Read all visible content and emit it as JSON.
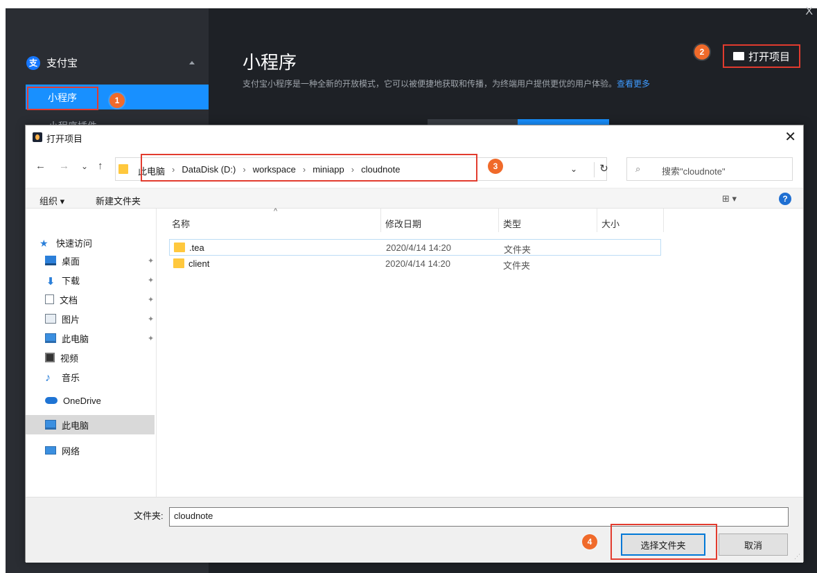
{
  "app": {
    "brand": "支付宝",
    "brand_logo": "支",
    "menu_active": "小程序",
    "menu_next": "小程序插件",
    "title": "小程序",
    "description": "支付宝小程序是一种全新的开放模式，它可以被便捷地获取和传播，为终端用户提供更优的用户体验。",
    "more_link": "查看更多",
    "open_project": "打开项目",
    "close": "X"
  },
  "badges": [
    "1",
    "2",
    "3",
    "4"
  ],
  "dialog": {
    "title": "打开项目",
    "close": "✕",
    "nav": {
      "back": "←",
      "forward": "→",
      "recent": "⌄",
      "up": "↑"
    },
    "breadcrumbs": [
      "此电脑",
      "DataDisk (D:)",
      "workspace",
      "miniapp",
      "cloudnote"
    ],
    "crumb_separator": "›",
    "address_dropdown": "⌄",
    "refresh": "↻",
    "search_icon": "⌕",
    "search_placeholder": "搜索\"cloudnote\"",
    "toolbar": {
      "organize": "组织 ▾",
      "new_folder": "新建文件夹",
      "view": "⊞ ▾",
      "help": "?"
    },
    "nav_pane": [
      {
        "label": "快速访问",
        "icon": "star-icon",
        "glyph": "★"
      },
      {
        "label": "桌面",
        "icon": "desktop-icon",
        "pinned": true,
        "pin": "✦"
      },
      {
        "label": "下载",
        "icon": "download-icon",
        "glyph": "⬇",
        "pinned": true,
        "pin": "✦"
      },
      {
        "label": "文档",
        "icon": "documents-icon",
        "pinned": true,
        "pin": "✦"
      },
      {
        "label": "图片",
        "icon": "pictures-icon",
        "pinned": true,
        "pin": "✦"
      },
      {
        "label": "此电脑",
        "icon": "computer-icon",
        "pinned": true,
        "pin": "✦"
      },
      {
        "label": "视频",
        "icon": "video-icon"
      },
      {
        "label": "音乐",
        "icon": "music-icon",
        "glyph": "♪"
      },
      {
        "label": "OneDrive",
        "icon": "onedrive-icon"
      },
      {
        "label": "此电脑",
        "icon": "computer-icon",
        "selected": true
      },
      {
        "label": "网络",
        "icon": "network-icon"
      }
    ],
    "columns": {
      "name": "名称",
      "sort": "^",
      "date": "修改日期",
      "type": "类型",
      "size": "大小"
    },
    "files": [
      {
        "name": ".tea",
        "date": "2020/4/14 14:20",
        "type": "文件夹"
      },
      {
        "name": "client",
        "date": "2020/4/14 14:20",
        "type": "文件夹"
      }
    ],
    "footer": {
      "folder_label": "文件夹:",
      "folder_value": "cloudnote",
      "select_button": "选择文件夹",
      "cancel_button": "取消",
      "grip": "⋰"
    }
  },
  "colors": {
    "highlight": "#e23b2e",
    "badge": "#f06a2a",
    "accent": "#1890ff"
  }
}
